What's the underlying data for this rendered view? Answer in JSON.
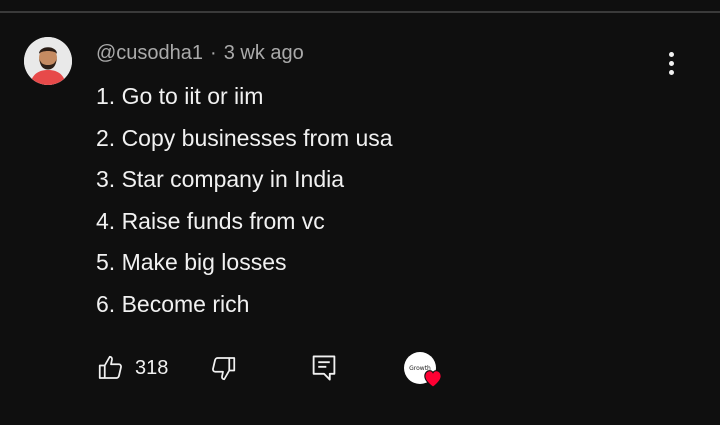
{
  "comment": {
    "author": "@cusodha1",
    "separator": "·",
    "time": "3 wk ago",
    "lines": [
      "1. Go to iit or iim",
      "2. Copy businesses from usa",
      "3. Star company in India",
      "4. Raise funds from vc",
      "5. Make big losses",
      "6. Become rich"
    ]
  },
  "actions": {
    "like_count": "318",
    "creator_mark": "Growth"
  },
  "icons": {
    "like": "thumb-up-icon",
    "dislike": "thumb-down-icon",
    "reply": "reply-comment-icon",
    "more": "more-vertical-icon",
    "creator_heart": "heart-icon"
  },
  "colors": {
    "background": "#0f0f0f",
    "text": "#f1f1f1",
    "meta": "#aaaaaa",
    "heart": "#ff0033",
    "avatar_shirt": "#e74a4a"
  }
}
